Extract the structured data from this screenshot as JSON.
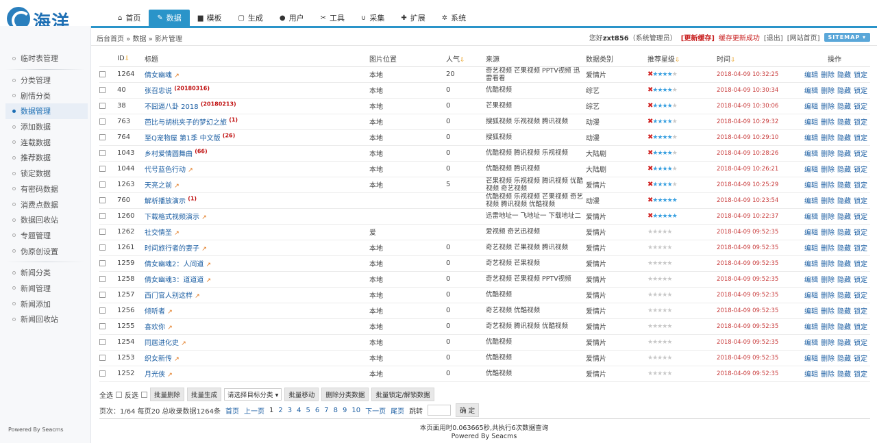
{
  "logo": {
    "text": "海洋"
  },
  "nav": [
    {
      "label": "首页",
      "icon": "home-icon",
      "glyph": "⌂"
    },
    {
      "label": "数据",
      "icon": "edit-icon",
      "glyph": "✎"
    },
    {
      "label": "模板",
      "icon": "file-icon",
      "glyph": "▆"
    },
    {
      "label": "生成",
      "icon": "doc-icon",
      "glyph": "▢"
    },
    {
      "label": "用户",
      "icon": "user-icon",
      "glyph": "●"
    },
    {
      "label": "工具",
      "icon": "wrench-icon",
      "glyph": "✂"
    },
    {
      "label": "采集",
      "icon": "magnet-icon",
      "glyph": "∪"
    },
    {
      "label": "扩展",
      "icon": "puzzle-icon",
      "glyph": "✚"
    },
    {
      "label": "系统",
      "icon": "gear-icon",
      "glyph": "✲"
    }
  ],
  "sidebar": {
    "groups": [
      [
        "临时表管理"
      ],
      [
        "分类管理",
        "剧情分类",
        "数据管理",
        "添加数据",
        "连载数据",
        "推荐数据",
        "锁定数据",
        "有密码数据",
        "消费点数据",
        "数据回收站",
        "专题管理",
        "伪原创设置"
      ],
      [
        "新闻分类",
        "新闻管理",
        "新闻添加",
        "新闻回收站"
      ]
    ],
    "active": "数据管理",
    "powered": "Powered By Seacms"
  },
  "breadcrumb": "后台首页 » 数据 » 影片管理",
  "status": {
    "greeting": "您好",
    "user": "zxt856",
    "role": "（系统管理员）",
    "refresh": "[更新缓存]",
    "refresh_ok": "缓存更新成功",
    "logout": "[退出]",
    "site_home": "[网站首页]",
    "sitemap": "SITEMAP ▾"
  },
  "table": {
    "headers": {
      "id": "ID",
      "title": "标题",
      "pic": "图片位置",
      "hits": "人气",
      "source": "来源",
      "type": "数据类别",
      "stars": "推荐星级",
      "time": "时间",
      "ops": "操作"
    },
    "ops": [
      "编辑",
      "删除",
      "隐藏",
      "锁定"
    ],
    "rows": [
      {
        "id": "1264",
        "title": "倩女幽魂",
        "tag": "",
        "hot": true,
        "pic": "本地",
        "hits": "20",
        "source": "奇艺视频 芒果视频 PPTV视频 迅雷看看",
        "type": "爱情片",
        "x": true,
        "stars": 4,
        "time": "2018-04-09 10:32:25"
      },
      {
        "id": "40",
        "title": "张召忠说",
        "tag": "(20180316)",
        "hot": false,
        "pic": "本地",
        "hits": "0",
        "source": "优酷视频",
        "type": "综艺",
        "x": true,
        "stars": 4,
        "time": "2018-04-09 10:30:34"
      },
      {
        "id": "38",
        "title": "不囧逼八卦 2018",
        "tag": "(20180213)",
        "hot": false,
        "pic": "本地",
        "hits": "0",
        "source": "芒果视频",
        "type": "综艺",
        "x": true,
        "stars": 4,
        "time": "2018-04-09 10:30:06"
      },
      {
        "id": "763",
        "title": "芭比与胡桃夹子的梦幻之旅",
        "tag": "(1)",
        "hot": false,
        "pic": "本地",
        "hits": "0",
        "source": "搜狐视频 乐视视频 腾讯视频",
        "type": "动漫",
        "x": true,
        "stars": 4,
        "time": "2018-04-09 10:29:32"
      },
      {
        "id": "764",
        "title": "至Q宠物屋 第1季 中文版",
        "tag": "(26)",
        "hot": false,
        "pic": "本地",
        "hits": "0",
        "source": "搜狐视频",
        "type": "动漫",
        "x": true,
        "stars": 4,
        "time": "2018-04-09 10:29:10"
      },
      {
        "id": "1043",
        "title": "乡村爱情圆舞曲",
        "tag": "(66)",
        "hot": false,
        "pic": "本地",
        "hits": "0",
        "source": "优酷视频 腾讯视频 乐视视频",
        "type": "大陆剧",
        "x": true,
        "stars": 4,
        "time": "2018-04-09 10:28:26"
      },
      {
        "id": "1044",
        "title": "代号蓝色行动",
        "tag": "",
        "hot": true,
        "pic": "本地",
        "hits": "0",
        "source": "优酷视频 腾讯视频",
        "type": "大陆剧",
        "x": true,
        "stars": 4,
        "time": "2018-04-09 10:26:21"
      },
      {
        "id": "1263",
        "title": "天亮之前",
        "tag": "",
        "hot": true,
        "pic": "本地",
        "hits": "5",
        "source": "芒果视频 乐视视频 腾讯视频 优酷视频 奇艺视频",
        "type": "爱情片",
        "x": true,
        "stars": 4,
        "time": "2018-04-09 10:25:29"
      },
      {
        "id": "760",
        "title": "解析播放演示",
        "tag": "(1)",
        "hot": false,
        "pic": "",
        "hits": "",
        "source": "优酷视频 乐视视频 芒果视频 奇艺视频 腾讯视频 优酷视频",
        "type": "动漫",
        "x": true,
        "stars": 5,
        "time": "2018-04-09 10:23:54"
      },
      {
        "id": "1260",
        "title": "下载格式视频演示",
        "tag": "",
        "hot": true,
        "pic": "",
        "hits": "",
        "source": "迅雷地址一 飞地址一 下载地址二",
        "type": "爱情片",
        "x": true,
        "stars": 5,
        "time": "2018-04-09 10:22:37"
      },
      {
        "id": "1262",
        "title": "社交情圣",
        "tag": "",
        "hot": true,
        "pic": "爱",
        "hits": "",
        "source": "爱视频 奇艺迅视频",
        "type": "爱情片",
        "x": false,
        "stars": 0,
        "time": "2018-04-09 09:52:35"
      },
      {
        "id": "1261",
        "title": "时间旅行者的妻子",
        "tag": "",
        "hot": true,
        "pic": "本地",
        "hits": "0",
        "source": "奇艺视频 芒果视频 腾讯视频",
        "type": "爱情片",
        "x": false,
        "stars": 0,
        "time": "2018-04-09 09:52:35"
      },
      {
        "id": "1259",
        "title": "倩女幽魂2：人间道",
        "tag": "",
        "hot": true,
        "pic": "本地",
        "hits": "0",
        "source": "奇艺视频 芒果视频",
        "type": "爱情片",
        "x": false,
        "stars": 0,
        "time": "2018-04-09 09:52:35"
      },
      {
        "id": "1258",
        "title": "倩女幽魂3：道道道",
        "tag": "",
        "hot": true,
        "pic": "本地",
        "hits": "0",
        "source": "奇艺视频 芒果视频 PPTV视频",
        "type": "爱情片",
        "x": false,
        "stars": 0,
        "time": "2018-04-09 09:52:35"
      },
      {
        "id": "1257",
        "title": "西门官人别这样",
        "tag": "",
        "hot": true,
        "pic": "本地",
        "hits": "0",
        "source": "优酷视频",
        "type": "爱情片",
        "x": false,
        "stars": 0,
        "time": "2018-04-09 09:52:35"
      },
      {
        "id": "1256",
        "title": "倾听者",
        "tag": "",
        "hot": true,
        "pic": "本地",
        "hits": "0",
        "source": "奇艺视频 优酷视频",
        "type": "爱情片",
        "x": false,
        "stars": 0,
        "time": "2018-04-09 09:52:35"
      },
      {
        "id": "1255",
        "title": "喜欢你",
        "tag": "",
        "hot": true,
        "pic": "本地",
        "hits": "0",
        "source": "奇艺视频 腾讯视频 优酷视频",
        "type": "爱情片",
        "x": false,
        "stars": 0,
        "time": "2018-04-09 09:52:35"
      },
      {
        "id": "1254",
        "title": "同居进化史",
        "tag": "",
        "hot": true,
        "pic": "本地",
        "hits": "0",
        "source": "优酷视频",
        "type": "爱情片",
        "x": false,
        "stars": 0,
        "time": "2018-04-09 09:52:35"
      },
      {
        "id": "1253",
        "title": "织女新传",
        "tag": "",
        "hot": true,
        "pic": "本地",
        "hits": "0",
        "source": "优酷视频",
        "type": "爱情片",
        "x": false,
        "stars": 0,
        "time": "2018-04-09 09:52:35"
      },
      {
        "id": "1252",
        "title": "月光侠",
        "tag": "",
        "hot": true,
        "pic": "本地",
        "hits": "0",
        "source": "优酷视频",
        "type": "爱情片",
        "x": false,
        "stars": 0,
        "time": "2018-04-09 09:52:35"
      }
    ]
  },
  "batch": {
    "select_all": "全选",
    "invert": "反选",
    "delete": "批量删除",
    "generate": "批量生成",
    "category_select": "请选择目标分类",
    "move": "批量移动",
    "delete_category": "删除分类数据",
    "lock": "批量锁定/解锁数据"
  },
  "pager": {
    "info": "页次：1/64 每页20 总收录数据1264条",
    "first": "首页",
    "prev": "上一页",
    "pages": [
      "1",
      "2",
      "3",
      "4",
      "5",
      "6",
      "7",
      "8",
      "9",
      "10"
    ],
    "next": "下一页",
    "last": "尾页",
    "jump": "跳转",
    "confirm": "确 定"
  },
  "footer": {
    "line1": "本页面用时0.063665秒,共执行6次数据查询",
    "line2": "Powered By Seacms"
  }
}
